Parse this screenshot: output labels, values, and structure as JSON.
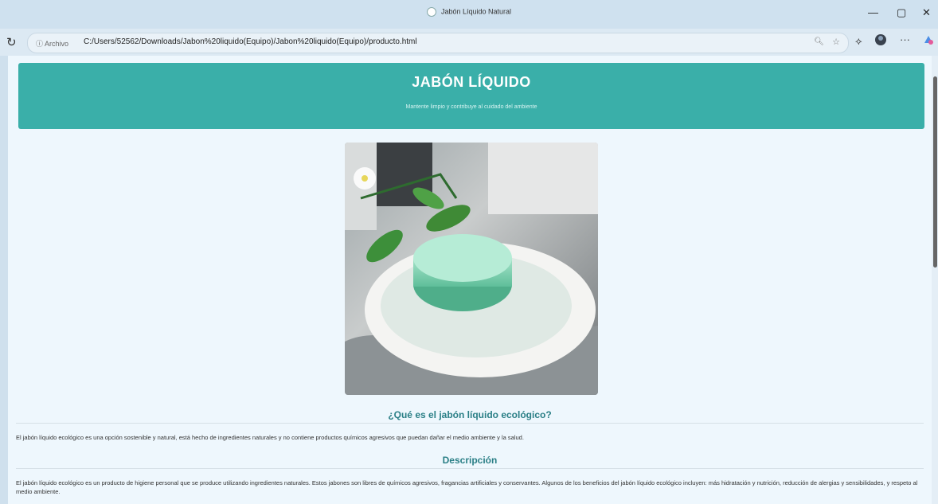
{
  "browser": {
    "window_title": "Jabón Líquido Natural",
    "controls": {
      "minimize": "—",
      "maximize": "▢",
      "close": "✕"
    },
    "address": {
      "info_label": "Archivo",
      "url": "C:/Users/52562/Downloads/Jabon%20liquido(Equipo)/Jabon%20liquido(Equipo)/producto.html"
    }
  },
  "page": {
    "header": {
      "title": "JABÓN LÍQUIDO",
      "subtitle": "Mantente limpio y contribuye al cuidado del ambiente"
    },
    "sections": [
      {
        "title": "¿Qué es el jabón líquido ecológico?",
        "text": "El jabón líquido ecológico es una opción sostenible y natural, está hecho de ingredientes naturales y no contiene productos químicos agresivos que puedan dañar el medio ambiente y la salud."
      },
      {
        "title": "Descripción",
        "text": "El jabón líquido ecológico es un producto de higiene personal que se produce utilizando ingredientes naturales. Estos jabones son libres de químicos agresivos, fragancias artificiales y conservantes. Algunos de los beneficios del jabón líquido ecológico incluyen: más hidratación y nutrición, reducción de alergias y sensibilidades, y respeto al medio ambiente."
      }
    ]
  },
  "colors": {
    "header_bg": "#3aafa9",
    "section_title": "#2a7f86",
    "page_bg": "#eef7fd"
  }
}
